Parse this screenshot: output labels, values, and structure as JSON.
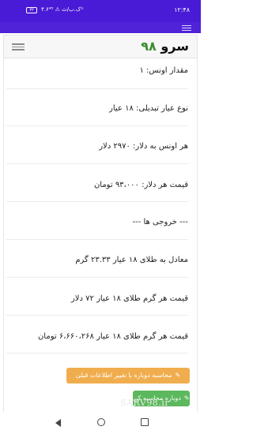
{
  "status_bar": {
    "time": "۱۲:۴۸",
    "indicators": "۳.۶ک.ب/ث ⚠ ⁴⁵ᴳ",
    "battery": "۳۳"
  },
  "navbar": {
    "brand_text": "سرو",
    "brand_num": "۹۸"
  },
  "results": {
    "ounce_amount": "مقدار اونس: ۱",
    "karat_type": "نوع عیار تبدیلی: ۱۸ عیار",
    "ounce_usd": "هر اونس به دلار: ۲۹۷۰ دلار",
    "usd_price": "قیمت هر دلار: ۹۳،۰۰۰ تومان",
    "outputs_header": "--- خروجی ها ---",
    "equivalent_grams": "معادل به طلای ۱۸ عیار ۲۳.۳۳ گرم",
    "gram_price_usd": "قیمت هر گرم طلای ۱۸ عیار ۷۲ دلار",
    "gram_price_toman": "قیمت هر گرم طلای ۱۸ عیار ۶،۶۶۰،۲۶۸ تومان"
  },
  "buttons": {
    "recalc_with_edit": "محاسبه دوباره با تغییر اطلاعات قبلی",
    "recalc": "دوباره محاسبه کن"
  },
  "watermark": "SARV98.ir"
}
